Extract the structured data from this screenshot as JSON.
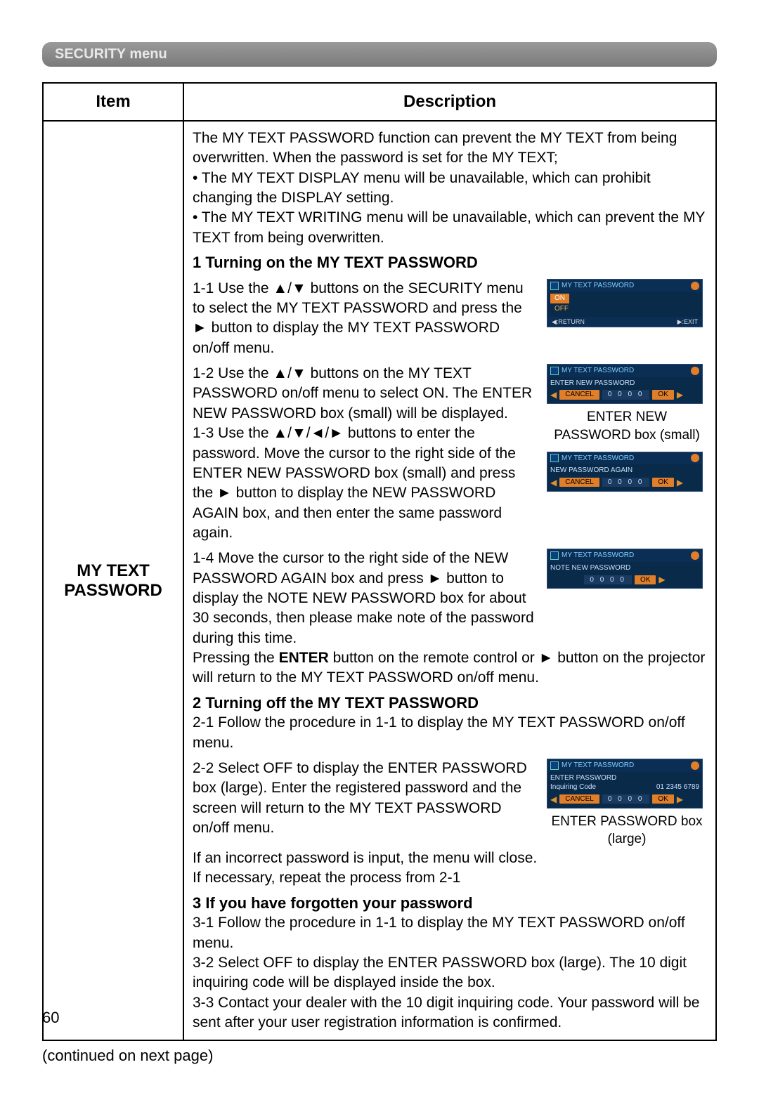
{
  "header": {
    "title": "SECURITY menu"
  },
  "table": {
    "headers": {
      "item": "Item",
      "description": "Description"
    },
    "item_label_1": "MY TEXT",
    "item_label_2": "PASSWORD"
  },
  "intro": {
    "p1": "The MY TEXT PASSWORD function can prevent the MY TEXT from being overwritten. When the password is set for the MY TEXT;",
    "b1": "• The MY TEXT DISPLAY menu will be unavailable, which can prohibit changing the DISPLAY setting.",
    "b2": "• The MY TEXT WRITING menu will be unavailable, which can prevent the MY TEXT from being overwritten."
  },
  "s1": {
    "title": "1 Turning on the MY TEXT PASSWORD",
    "step11": "1-1 Use the ▲/▼ buttons on the SECURITY menu to select the MY TEXT PASSWORD and press the ► button to display the MY TEXT PASSWORD on/off menu.",
    "step12": "1-2 Use the ▲/▼ buttons on the MY TEXT PASSWORD on/off menu to select ON. The ENTER NEW PASSWORD box (small) will be displayed.",
    "step13": "1-3 Use the ▲/▼/◄/► buttons to enter the password. Move the cursor to the right side of the ENTER NEW PASSWORD box (small) and press the ► button to display the NEW PASSWORD AGAIN box, and then enter the same password again.",
    "step14": "1-4 Move the cursor to the right side of the NEW PASSWORD AGAIN box and press ► button to display the NOTE NEW PASSWORD box for about 30 seconds, then please make note of the password during this time.",
    "post_a": "Pressing the ",
    "post_enter": "ENTER",
    "post_b": " button on the remote control or ► button on the projector will return to the MY TEXT PASSWORD on/off menu."
  },
  "s2": {
    "title": "2 Turning off the MY TEXT PASSWORD",
    "step21": "2-1 Follow the procedure in 1-1 to display the MY TEXT PASSWORD on/off menu.",
    "step22": "2-2 Select OFF to display the ENTER PASSWORD box (large). Enter the registered password and the screen will return to the MY TEXT PASSWORD on/off menu.",
    "post1": "If an incorrect password is input, the menu will close.",
    "post2": "If necessary, repeat the process from 2-1"
  },
  "s3": {
    "title": "3 If you have forgotten your password",
    "step31": "3-1 Follow the procedure in 1-1 to display the MY TEXT PASSWORD on/off menu.",
    "step32": "3-2 Select OFF to display the ENTER PASSWORD box (large). The 10 digit inquiring code will be displayed inside the box.",
    "step33": "3-3 Contact your dealer with the 10 digit inquiring code. Your password will be sent after your user registration information is confirmed."
  },
  "dlg": {
    "title": "MY TEXT PASSWORD",
    "on": "ON",
    "off": "OFF",
    "return": "◀:RETURN",
    "exit": "▶:EXIT",
    "enter_new": "ENTER NEW PASSWORD",
    "again": "NEW PASSWORD AGAIN",
    "note_new": "NOTE NEW PASSWORD",
    "enter_pw": "ENTER PASSWORD",
    "inquiring": "Inquiring Code",
    "inquiring_val": "01 2345 6789",
    "cancel": "CANCEL",
    "ok": "OK",
    "digits": "0 0 0 0"
  },
  "captions": {
    "small": "ENTER NEW PASSWORD box (small)",
    "large": "ENTER PASSWORD box (large)"
  },
  "footer": {
    "continued": "(continued on next page)",
    "pagenum": "60"
  }
}
